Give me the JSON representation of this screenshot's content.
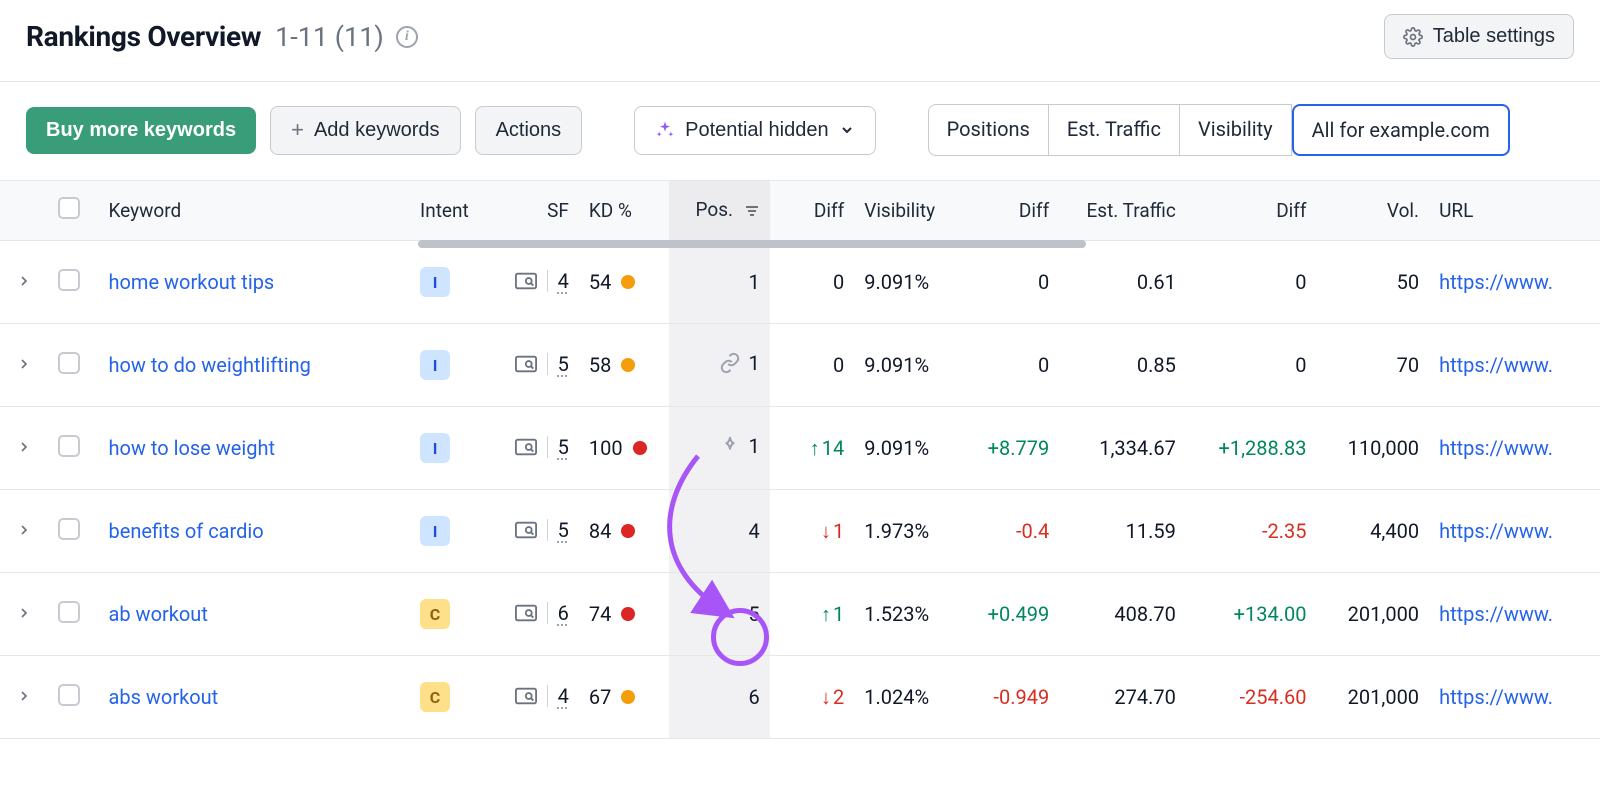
{
  "header": {
    "title": "Rankings Overview",
    "range": "1-11 (11)",
    "table_settings": "Table settings"
  },
  "toolbar": {
    "buy": "Buy more keywords",
    "add": "Add keywords",
    "actions": "Actions",
    "potential": "Potential hidden",
    "segments": {
      "positions": "Positions",
      "est_traffic": "Est. Traffic",
      "visibility": "Visibility",
      "all_for": "All for example.com"
    }
  },
  "columns": {
    "keyword": "Keyword",
    "intent": "Intent",
    "sf": "SF",
    "kd": "KD %",
    "pos": "Pos.",
    "diff": "Diff",
    "visibility": "Visibility",
    "vdiff": "Diff",
    "traffic": "Est. Traffic",
    "tdiff": "Diff",
    "vol": "Vol.",
    "url": "URL"
  },
  "rows": [
    {
      "keyword": "home workout tips",
      "intent": "I",
      "sf": "4",
      "kd": "54",
      "kd_color": "#f59e0b",
      "pos": "1",
      "pos_icon": "",
      "diff": "0",
      "diff_dir": "zero",
      "visibility": "9.091%",
      "vdiff": "0",
      "vdiff_dir": "zero",
      "traffic": "0.61",
      "tdiff": "0",
      "tdiff_dir": "zero",
      "vol": "50",
      "url": "https://www."
    },
    {
      "keyword": "how to do weightlifting",
      "intent": "I",
      "sf": "5",
      "kd": "58",
      "kd_color": "#f59e0b",
      "pos": "1",
      "pos_icon": "link",
      "diff": "0",
      "diff_dir": "zero",
      "visibility": "9.091%",
      "vdiff": "0",
      "vdiff_dir": "zero",
      "traffic": "0.85",
      "tdiff": "0",
      "tdiff_dir": "zero",
      "vol": "70",
      "url": "https://www."
    },
    {
      "keyword": "how to lose weight",
      "intent": "I",
      "sf": "5",
      "kd": "100",
      "kd_color": "#dc2626",
      "pos": "1",
      "pos_icon": "star",
      "diff": "14",
      "diff_dir": "up",
      "visibility": "9.091%",
      "vdiff": "+8.779",
      "vdiff_dir": "pos",
      "traffic": "1,334.67",
      "tdiff": "+1,288.83",
      "tdiff_dir": "pos",
      "vol": "110,000",
      "url": "https://www."
    },
    {
      "keyword": "benefits of cardio",
      "intent": "I",
      "sf": "5",
      "kd": "84",
      "kd_color": "#dc2626",
      "pos": "4",
      "pos_icon": "",
      "diff": "1",
      "diff_dir": "down",
      "visibility": "1.973%",
      "vdiff": "-0.4",
      "vdiff_dir": "neg",
      "traffic": "11.59",
      "tdiff": "-2.35",
      "tdiff_dir": "neg",
      "vol": "4,400",
      "url": "https://www."
    },
    {
      "keyword": "ab workout",
      "intent": "C",
      "sf": "6",
      "kd": "74",
      "kd_color": "#dc2626",
      "pos": "5",
      "pos_icon": "",
      "diff": "1",
      "diff_dir": "up",
      "visibility": "1.523%",
      "vdiff": "+0.499",
      "vdiff_dir": "pos",
      "traffic": "408.70",
      "tdiff": "+134.00",
      "tdiff_dir": "pos",
      "vol": "201,000",
      "url": "https://www."
    },
    {
      "keyword": "abs workout",
      "intent": "C",
      "sf": "4",
      "kd": "67",
      "kd_color": "#f59e0b",
      "pos": "6",
      "pos_icon": "",
      "diff": "2",
      "diff_dir": "down",
      "visibility": "1.024%",
      "vdiff": "-0.949",
      "vdiff_dir": "neg",
      "traffic": "274.70",
      "tdiff": "-254.60",
      "tdiff_dir": "neg",
      "vol": "201,000",
      "url": "https://www."
    }
  ]
}
